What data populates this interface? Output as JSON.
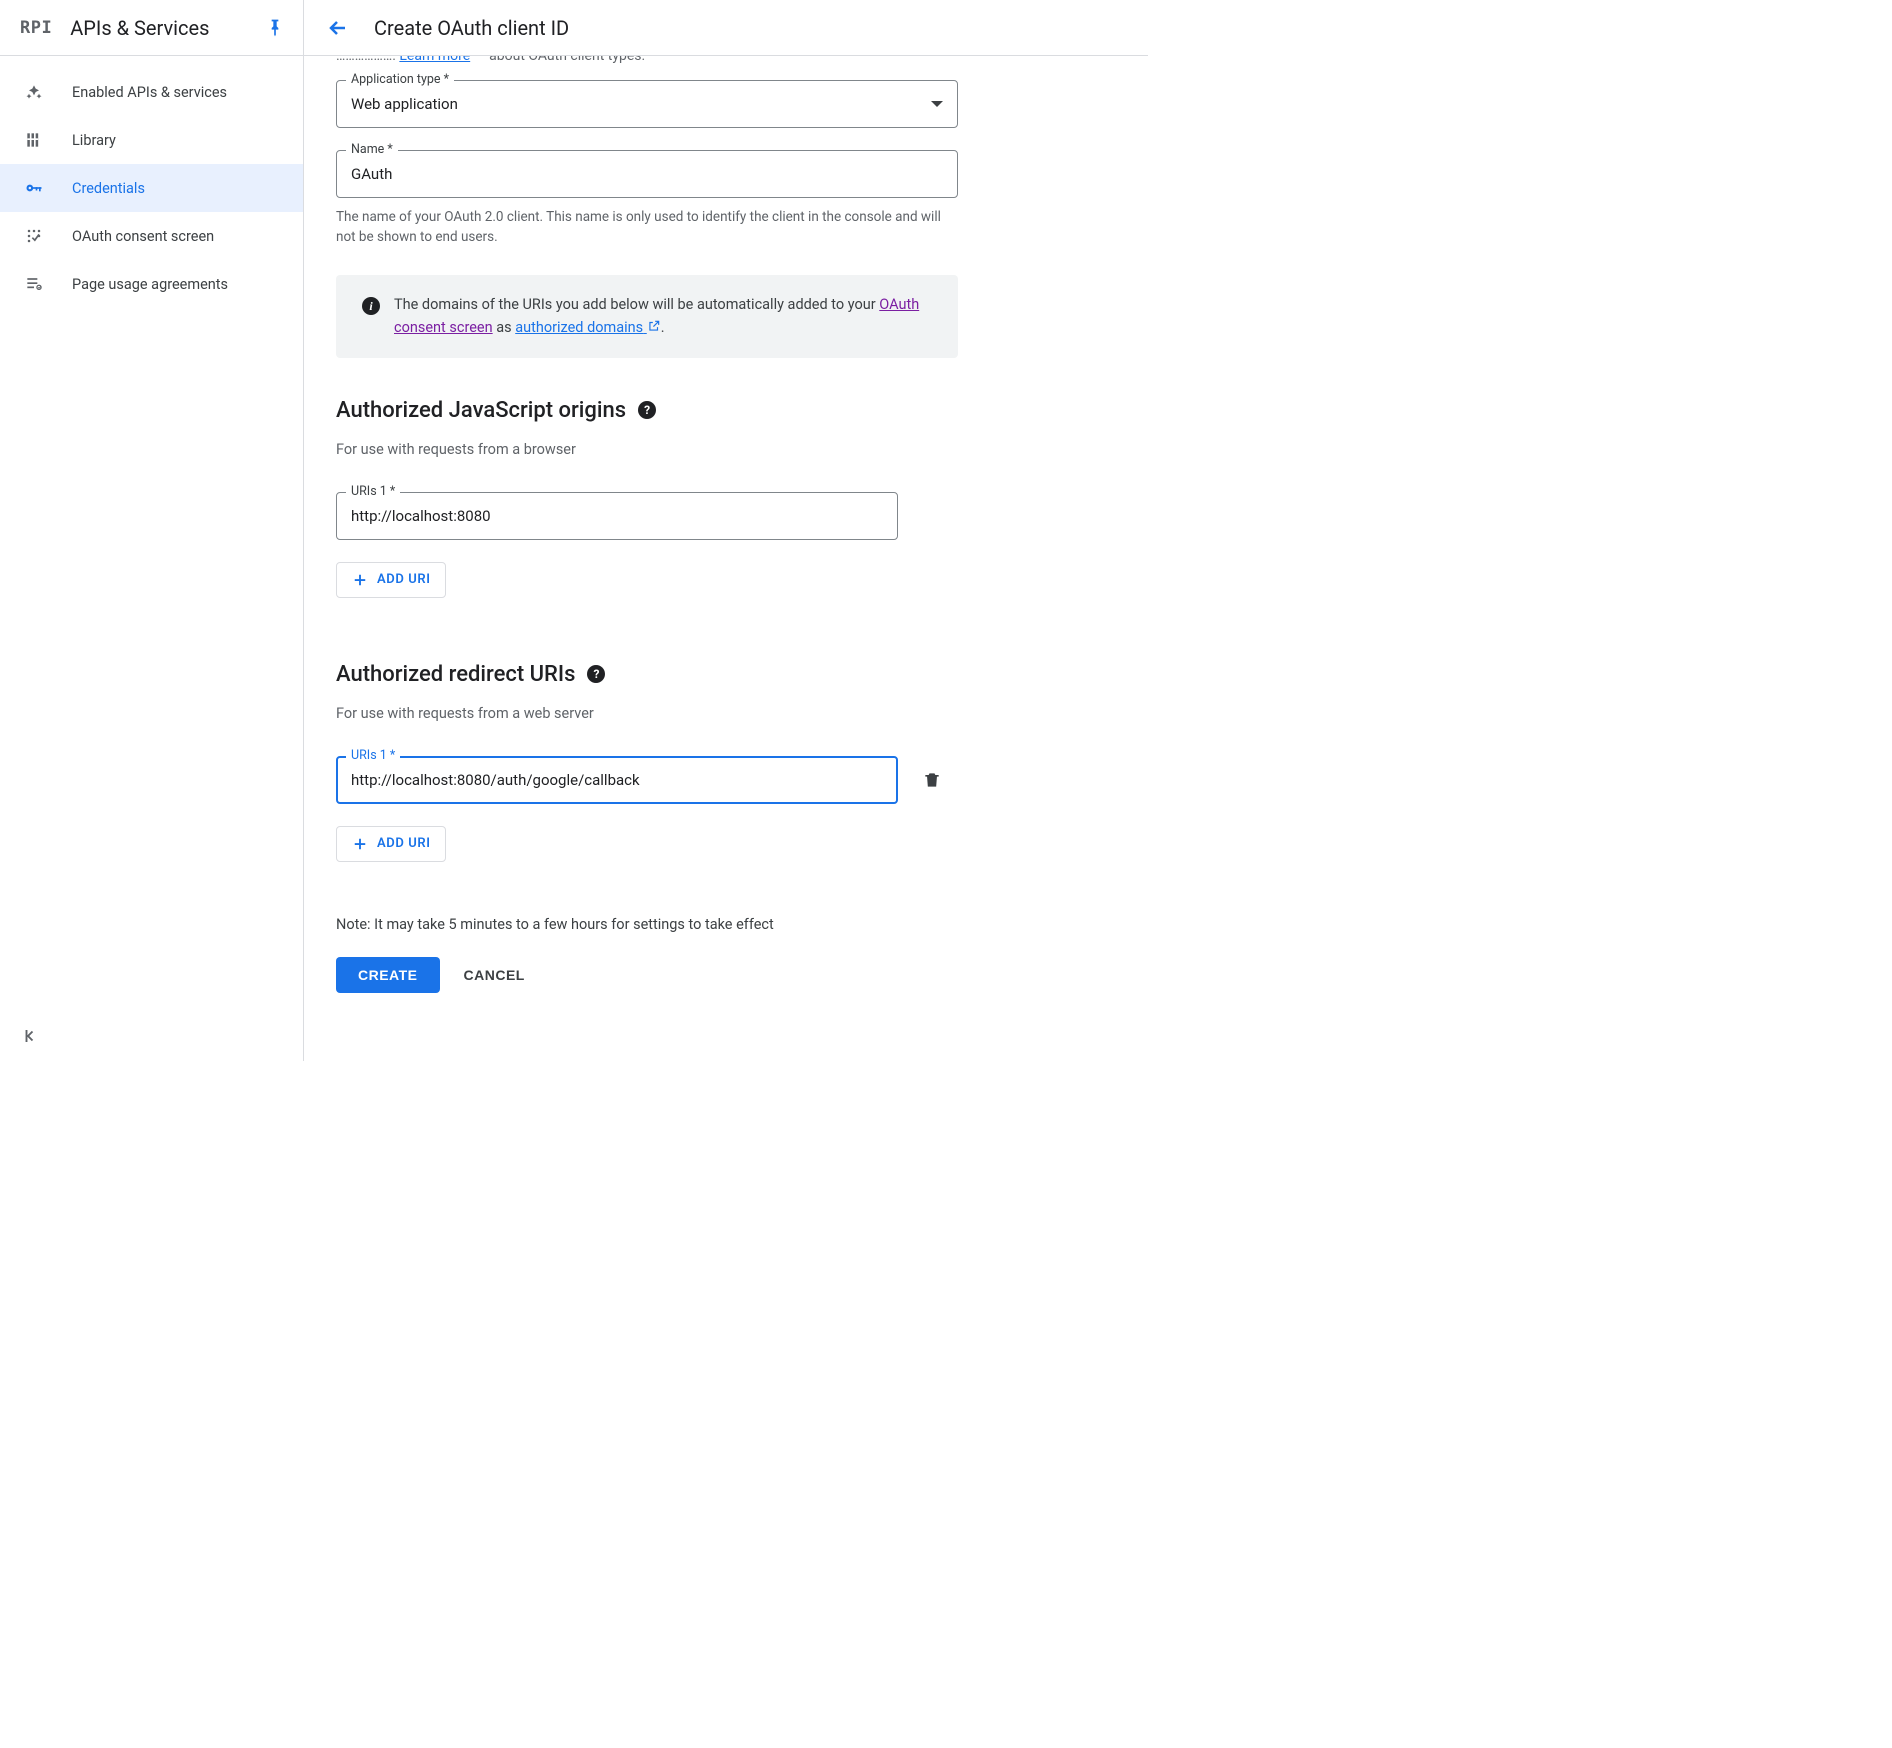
{
  "header": {
    "product": "APIs & Services",
    "pageTitle": "Create OAuth client ID"
  },
  "sidebar": {
    "items": [
      {
        "id": "enabled",
        "label": "Enabled APIs & services"
      },
      {
        "id": "library",
        "label": "Library"
      },
      {
        "id": "credentials",
        "label": "Credentials"
      },
      {
        "id": "consent",
        "label": "OAuth consent screen"
      },
      {
        "id": "agreements",
        "label": "Page usage agreements"
      }
    ]
  },
  "truncated": {
    "linkText": "Learn more",
    "tail": " about OAuth client types."
  },
  "appType": {
    "label": "Application type *",
    "value": "Web application"
  },
  "name": {
    "label": "Name *",
    "value": "GAuth",
    "helper": "The name of your OAuth 2.0 client. This name is only used to identify the client in the console and will not be shown to end users."
  },
  "infoBanner": {
    "pre": "The domains of the URIs you add below will be automatically added to your ",
    "consentLink": "OAuth consent screen",
    "mid": " as ",
    "authLink": "authorized domains",
    "post": "."
  },
  "origins": {
    "title": "Authorized JavaScript origins",
    "desc": "For use with requests from a browser",
    "fieldLabel": "URIs 1 *",
    "value": "http://localhost:8080",
    "addBtn": "Add URI"
  },
  "redirects": {
    "title": "Authorized redirect URIs",
    "desc": "For use with requests from a web server",
    "fieldLabel": "URIs 1 *",
    "value": "http://localhost:8080/auth/google/callback",
    "addBtn": "Add URI"
  },
  "note": "Note: It may take 5 minutes to a few hours for settings to take effect",
  "actions": {
    "create": "CREATE",
    "cancel": "CANCEL"
  }
}
